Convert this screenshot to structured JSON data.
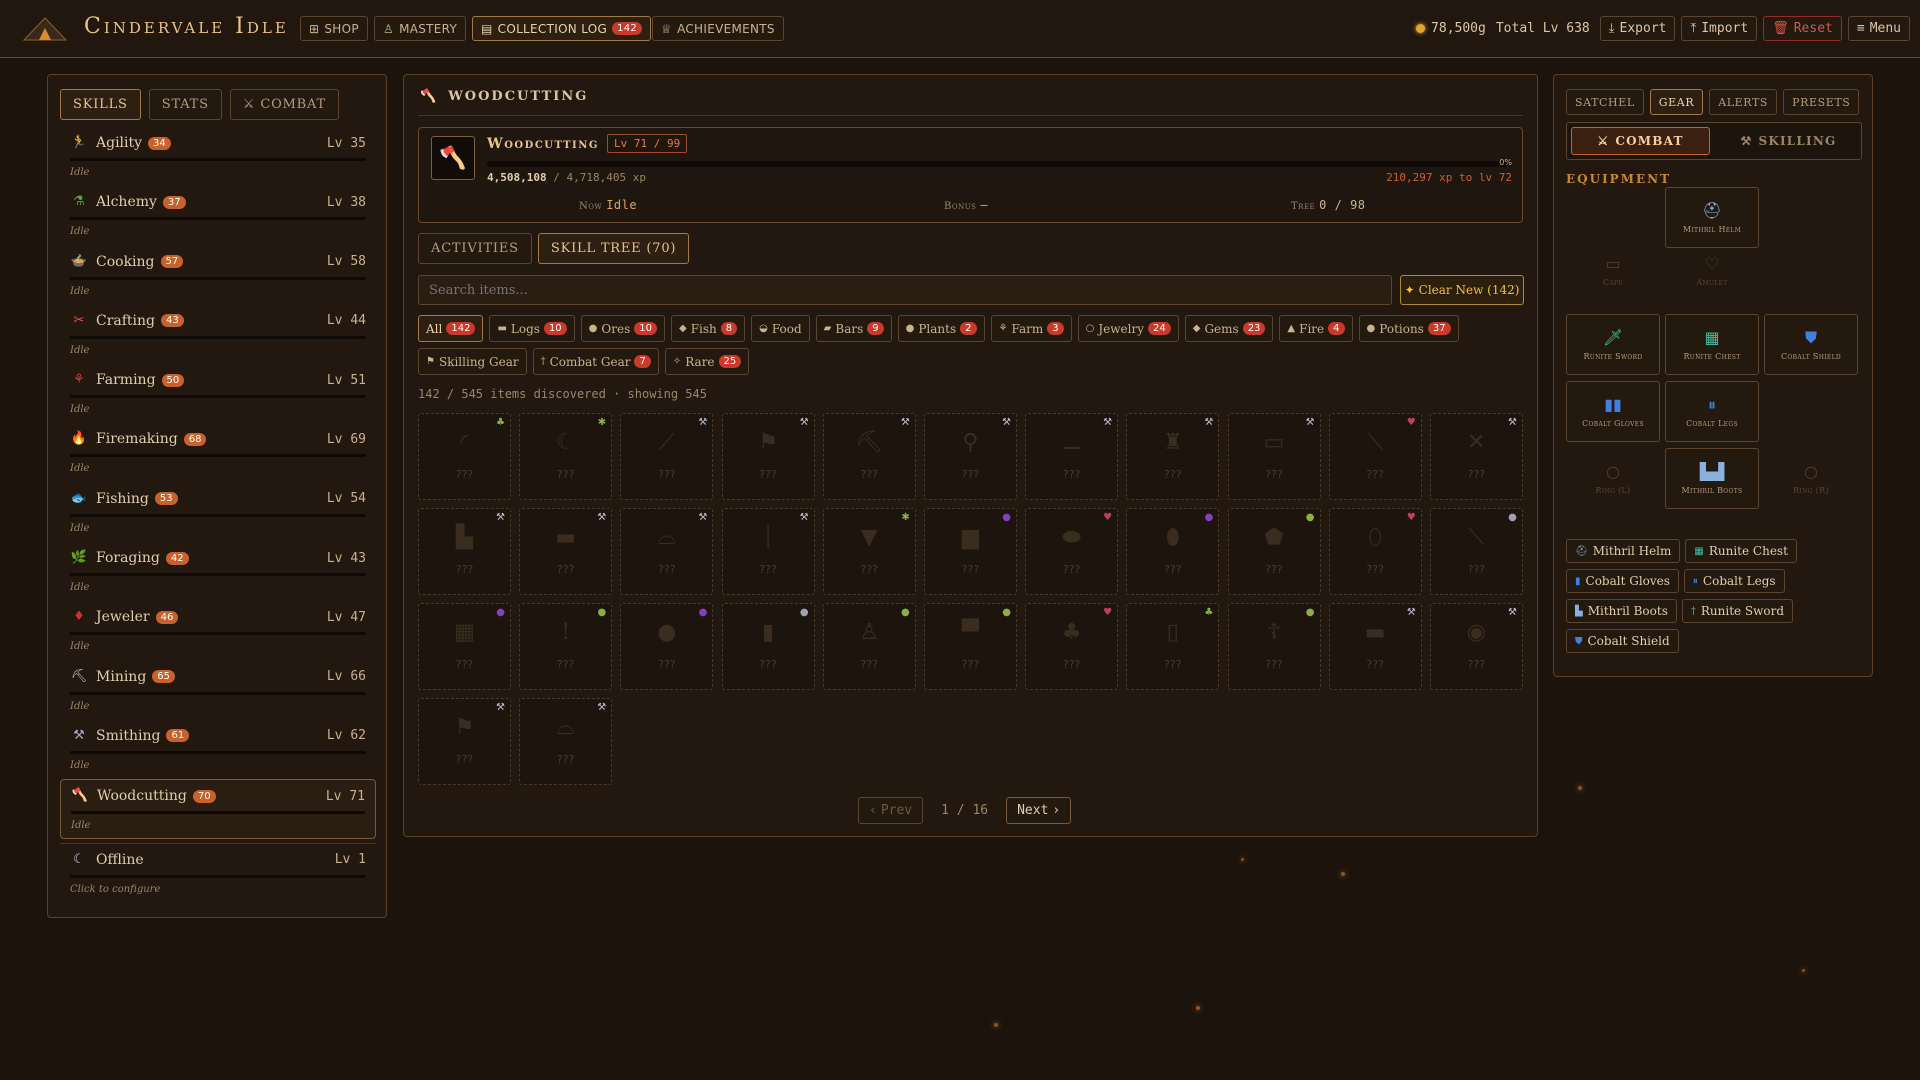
{
  "app": {
    "title": "Cindervale Idle",
    "nav": [
      {
        "id": "shop",
        "label": "SHOP",
        "icon": "shop-icon"
      },
      {
        "id": "mastery",
        "label": "MASTERY",
        "icon": "flask-icon"
      },
      {
        "id": "collection",
        "label": "COLLECTION LOG",
        "icon": "book-icon",
        "badge": "142"
      },
      {
        "id": "achievements",
        "label": "ACHIEVEMENTS",
        "icon": "trophy-icon"
      }
    ],
    "gold": "78,500g",
    "total_level": "Total Lv 638",
    "actions": {
      "export": "Export",
      "import": "Import",
      "reset": "Reset",
      "menu": "Menu"
    }
  },
  "left": {
    "tabs": {
      "skills": "SKILLS",
      "stats": "STATS",
      "combat": "COMBAT"
    },
    "skills": [
      {
        "name": "Agility",
        "badge": "34",
        "level": "Lv 35",
        "status": "Idle",
        "icon": "🏃",
        "color": "#d05030"
      },
      {
        "name": "Alchemy",
        "badge": "37",
        "level": "Lv 38",
        "status": "Idle",
        "icon": "⚗",
        "color": "#5aa040"
      },
      {
        "name": "Cooking",
        "badge": "57",
        "level": "Lv 58",
        "status": "Idle",
        "icon": "🍲",
        "color": "#b08050"
      },
      {
        "name": "Crafting",
        "badge": "43",
        "level": "Lv 44",
        "status": "Idle",
        "icon": "✂",
        "color": "#d06040"
      },
      {
        "name": "Farming",
        "badge": "50",
        "level": "Lv 51",
        "status": "Idle",
        "icon": "⚘",
        "color": "#d04040"
      },
      {
        "name": "Firemaking",
        "badge": "68",
        "level": "Lv 69",
        "status": "Idle",
        "icon": "🔥",
        "color": "#f0a030"
      },
      {
        "name": "Fishing",
        "badge": "53",
        "level": "Lv 54",
        "status": "Idle",
        "icon": "🐟",
        "color": "#5090d0"
      },
      {
        "name": "Foraging",
        "badge": "42",
        "level": "Lv 43",
        "status": "Idle",
        "icon": "🌿",
        "color": "#70b040"
      },
      {
        "name": "Jeweler",
        "badge": "46",
        "level": "Lv 47",
        "status": "Idle",
        "icon": "♦",
        "color": "#d03030"
      },
      {
        "name": "Mining",
        "badge": "65",
        "level": "Lv 66",
        "status": "Idle",
        "icon": "⛏",
        "color": "#c0c0c0"
      },
      {
        "name": "Smithing",
        "badge": "61",
        "level": "Lv 62",
        "status": "Idle",
        "icon": "⚒",
        "color": "#b0a0c0"
      },
      {
        "name": "Woodcutting",
        "badge": "70",
        "level": "Lv 71",
        "status": "Idle",
        "icon": "🪓",
        "color": "#d0d0d0"
      },
      {
        "name": "Offline",
        "badge": "",
        "level": "Lv 1",
        "status": "Click to configure",
        "icon": "☾",
        "color": "#d0d0e0"
      }
    ]
  },
  "center": {
    "title": "WOODCUTTING",
    "card": {
      "name": "Woodcutting",
      "level": "Lv 71 / 99",
      "xp_current": "4,508,108",
      "xp_total": "/ 4,718,405 xp",
      "xp_next": "210,297 xp to lv 72",
      "xp_pct_label": "0%",
      "xp_fraction": 0.0,
      "now_label": "Now",
      "now_value": "Idle",
      "bonus_label": "Bonus",
      "bonus_value": "—",
      "tree_label": "Tree",
      "tree_value": "0 / 98"
    },
    "subtabs": {
      "activities": "ACTIVITIES",
      "skilltree": "SKILL TREE (70)"
    },
    "search_placeholder": "Search items...",
    "clear_new": "Clear New (142)",
    "chips": [
      {
        "label": "All",
        "badge": "142",
        "icon": "",
        "active": true
      },
      {
        "label": "Logs",
        "badge": "10",
        "icon": "▬"
      },
      {
        "label": "Ores",
        "badge": "10",
        "icon": "●"
      },
      {
        "label": "Fish",
        "badge": "8",
        "icon": "◆"
      },
      {
        "label": "Food",
        "badge": "",
        "icon": "◒"
      },
      {
        "label": "Bars",
        "badge": "9",
        "icon": "▰"
      },
      {
        "label": "Plants",
        "badge": "2",
        "icon": "●"
      },
      {
        "label": "Farm",
        "badge": "3",
        "icon": "⚘"
      },
      {
        "label": "Jewelry",
        "badge": "24",
        "icon": "○"
      },
      {
        "label": "Gems",
        "badge": "23",
        "icon": "◆"
      },
      {
        "label": "Fire",
        "badge": "4",
        "icon": "▲"
      },
      {
        "label": "Potions",
        "badge": "37",
        "icon": "●"
      },
      {
        "label": "Skilling Gear",
        "badge": "",
        "icon": "⚑"
      },
      {
        "label": "Combat Gear",
        "badge": "7",
        "icon": "†"
      },
      {
        "label": "Rare",
        "badge": "25",
        "icon": "✧"
      }
    ],
    "discovered": "142 / 545 items discovered · showing 545",
    "items": [
      {
        "sil": "◜",
        "corner": "♣",
        "cc": "#8ab040"
      },
      {
        "sil": "☾",
        "corner": "✱",
        "cc": "#8ab040"
      },
      {
        "sil": "⟋",
        "corner": "⚒",
        "cc": "#c0c0d0"
      },
      {
        "sil": "⚑",
        "corner": "⚒",
        "cc": "#c0c0d0"
      },
      {
        "sil": "⛏",
        "corner": "⚒",
        "cc": "#c0c0d0"
      },
      {
        "sil": "⚲",
        "corner": "⚒",
        "cc": "#c0c0d0"
      },
      {
        "sil": "⚊",
        "corner": "⚒",
        "cc": "#c0c0d0"
      },
      {
        "sil": "♜",
        "corner": "⚒",
        "cc": "#c0c0d0"
      },
      {
        "sil": "▭",
        "corner": "⚒",
        "cc": "#c0c0d0"
      },
      {
        "sil": "⟍",
        "corner": "♥",
        "cc": "#c04060"
      },
      {
        "sil": "✕",
        "corner": "⚒",
        "cc": "#c0c0d0"
      },
      {
        "sil": "▙",
        "corner": "⚒",
        "cc": "#c0c0d0"
      },
      {
        "sil": "▬",
        "corner": "⚒",
        "cc": "#c0c0d0"
      },
      {
        "sil": "⌓",
        "corner": "⚒",
        "cc": "#c0c0d0"
      },
      {
        "sil": "⏐",
        "corner": "⚒",
        "cc": "#c0c0d0"
      },
      {
        "sil": "▼",
        "corner": "✱",
        "cc": "#8ab040"
      },
      {
        "sil": "▆",
        "corner": "●",
        "cc": "#8040c0"
      },
      {
        "sil": "⬬",
        "corner": "♥",
        "cc": "#c04060"
      },
      {
        "sil": "⬮",
        "corner": "●",
        "cc": "#8040c0"
      },
      {
        "sil": "⬟",
        "corner": "●",
        "cc": "#8ab040"
      },
      {
        "sil": "⬯",
        "corner": "♥",
        "cc": "#c04060"
      },
      {
        "sil": "⟍",
        "corner": "●",
        "cc": "#a0a0b0"
      },
      {
        "sil": "▦",
        "corner": "●",
        "cc": "#8040c0"
      },
      {
        "sil": "!",
        "corner": "●",
        "cc": "#8ab040"
      },
      {
        "sil": "●",
        "corner": "●",
        "cc": "#8040c0"
      },
      {
        "sil": "▮",
        "corner": "●",
        "cc": "#a0a0b0"
      },
      {
        "sil": "♙",
        "corner": "●",
        "cc": "#8ab040"
      },
      {
        "sil": "▀",
        "corner": "●",
        "cc": "#8ab040"
      },
      {
        "sil": "♣",
        "corner": "♥",
        "cc": "#c04060"
      },
      {
        "sil": "▯",
        "corner": "♣",
        "cc": "#8ab040"
      },
      {
        "sil": "☦",
        "corner": "●",
        "cc": "#8ab040"
      },
      {
        "sil": "▬",
        "corner": "⚒",
        "cc": "#c0c0d0"
      },
      {
        "sil": "◉",
        "corner": "⚒",
        "cc": "#c0c0d0"
      },
      {
        "sil": "⚑",
        "corner": "⚒",
        "cc": "#c0c0d0"
      },
      {
        "sil": "⌓",
        "corner": "⚒",
        "cc": "#c0c0d0"
      }
    ],
    "item_placeholder": "???",
    "pager": {
      "prev": "Prev",
      "info": "1 / 16",
      "next": "Next"
    }
  },
  "right": {
    "tabs": {
      "satchel": "SATCHEL",
      "gear": "GEAR",
      "alerts": "ALERTS",
      "presets": "PRESETS"
    },
    "modes": {
      "combat": "COMBAT",
      "skilling": "SKILLING"
    },
    "equipment_title": "EQUIPMENT",
    "slots": {
      "helm": {
        "label": "Mithril Helm",
        "icon": "⛑",
        "color": "#8ab0e0"
      },
      "cape": {
        "label": "Cape",
        "icon": "▭",
        "color": "#9a8566"
      },
      "amulet": {
        "label": "Amulet",
        "icon": "♡",
        "color": "#9a8566"
      },
      "sword": {
        "label": "Runite Sword",
        "icon": "🗡",
        "color": "#40c0a0"
      },
      "chest": {
        "label": "Runite Chest",
        "icon": "▦",
        "color": "#40c0a0"
      },
      "shield": {
        "label": "Cobalt Shield",
        "icon": "⛊",
        "color": "#4080e0"
      },
      "gloves": {
        "label": "Cobalt Gloves",
        "icon": "▮▮",
        "color": "#4080e0"
      },
      "legs": {
        "label": "Cobalt Legs",
        "icon": "⏸",
        "color": "#4080e0"
      },
      "ringl": {
        "label": "Ring (L)",
        "icon": "○",
        "color": "#9a8566"
      },
      "boots": {
        "label": "Mithril Boots",
        "icon": "▙▟",
        "color": "#8ab0e0"
      },
      "ringr": {
        "label": "Ring (R)",
        "icon": "○",
        "color": "#9a8566"
      }
    },
    "equipped": [
      {
        "label": "Mithril Helm",
        "icon": "⛑",
        "color": "#8ab0e0"
      },
      {
        "label": "Runite Chest",
        "icon": "▦",
        "color": "#40c0a0"
      },
      {
        "label": "Cobalt Gloves",
        "icon": "▮",
        "color": "#4080e0"
      },
      {
        "label": "Cobalt Legs",
        "icon": "⏸",
        "color": "#4080e0"
      },
      {
        "label": "Mithril Boots",
        "icon": "▙",
        "color": "#8ab0e0"
      },
      {
        "label": "Runite Sword",
        "icon": "†",
        "color": "#40c0a0"
      },
      {
        "label": "Cobalt Shield",
        "icon": "⛊",
        "color": "#4080e0"
      }
    ]
  }
}
